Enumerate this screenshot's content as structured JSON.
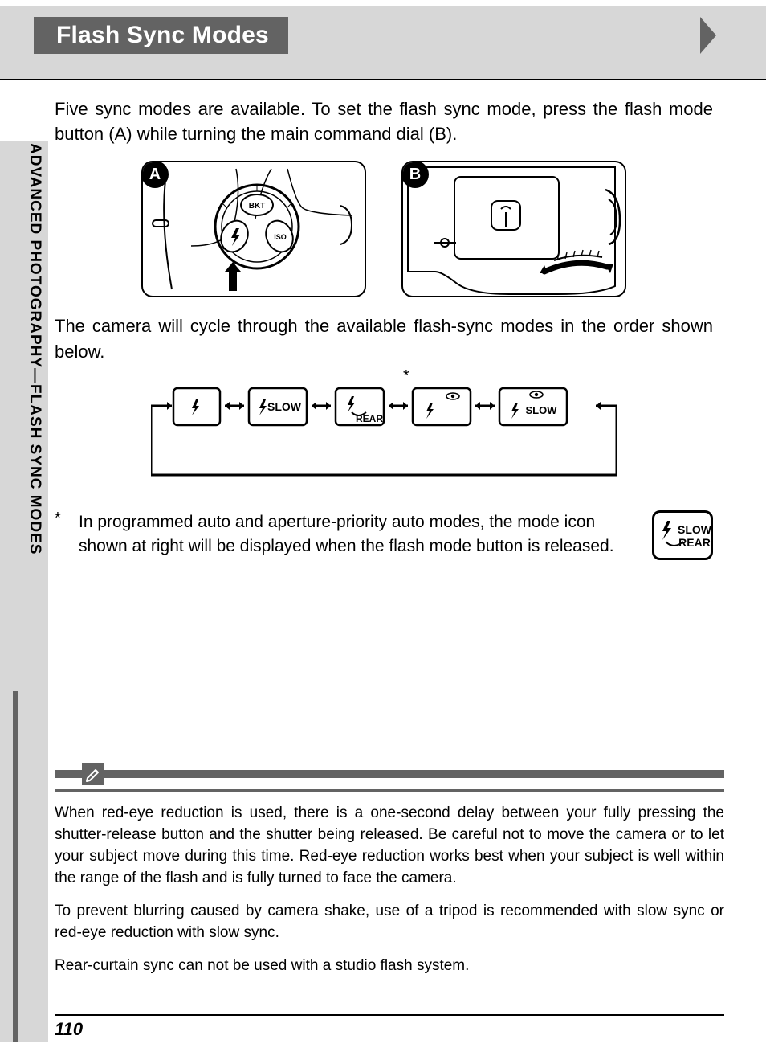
{
  "header": {
    "title": "Flash Sync Modes"
  },
  "sidebar": {
    "label": "ADVANCED PHOTOGRAPHY—FLASH SYNC MODES"
  },
  "intro_para": "Five sync modes are available.  To set the flash sync mode, press the flash mode button (A) while turning the main command dial (B).",
  "illustrations": [
    {
      "badge": "A",
      "labels": {
        "bkt": "BKT",
        "iso": "ISO"
      },
      "desc": "flash-mode-button"
    },
    {
      "badge": "B",
      "desc": "main-command-dial"
    }
  ],
  "cycle_para": "The camera will cycle through the available flash-sync modes in the order shown below.",
  "cycle_modes": [
    {
      "flash": true,
      "label": ""
    },
    {
      "flash": true,
      "label": "SLOW"
    },
    {
      "flash": true,
      "label": "REAR",
      "rear": true,
      "asterisk": true
    },
    {
      "flash": true,
      "eye": true,
      "label": ""
    },
    {
      "flash": true,
      "eye": true,
      "label": "SLOW"
    }
  ],
  "footnote": {
    "marker": "*",
    "text": "In programmed auto and aperture-priority auto modes, the mode icon shown at right will be displayed when the flash mode button is released.",
    "icon": {
      "flash": true,
      "slow": "SLOW",
      "rear": "REAR"
    }
  },
  "callout": {
    "paras": [
      "When red-eye reduction is used, there is a one-second delay between your fully pressing the shutter-release button and the shutter being released.  Be careful not to move the camera or to let your subject move during this time.  Red-eye reduction works best when your subject is well within the range of the flash and is fully turned to face the camera.",
      "To prevent blurring caused by camera shake, use of a tripod is recommended with slow sync or red-eye reduction with slow sync.",
      "Rear-curtain sync can not be used with a studio flash system."
    ]
  },
  "page_number": "110"
}
